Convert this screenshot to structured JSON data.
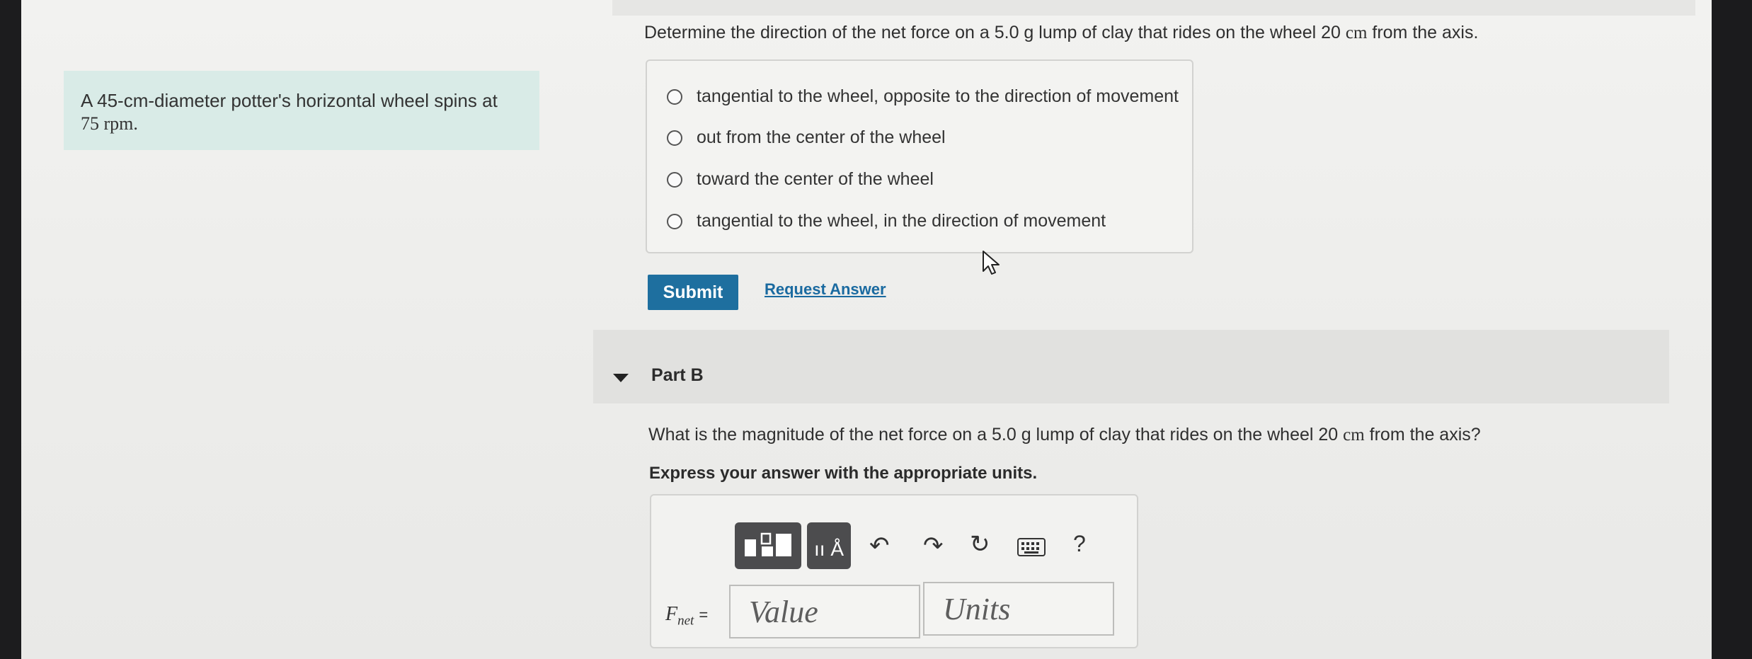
{
  "intro": {
    "text": "A 45-cm-diameter potter's horizontal wheel spins at",
    "rate": "75 rpm."
  },
  "part_a": {
    "question_prefix": "Determine the direction of the net force on a 5.0 g lump of clay that rides on the wheel 20",
    "question_unit": "cm",
    "question_suffix": "from the axis.",
    "options": [
      "tangential to the wheel, opposite to the direction of movement",
      "out from the center of the wheel",
      "toward the center of the wheel",
      "tangential to the wheel, in the direction of movement"
    ],
    "submit_label": "Submit",
    "request_label": "Request Answer"
  },
  "part_b": {
    "title": "Part B",
    "question_prefix": "What is the magnitude of the net force on a 5.0 g lump of clay that rides on the wheel 20",
    "question_unit": "cm",
    "question_suffix": "from the axis?",
    "instruction": "Express your answer with the appropriate units.",
    "help_label": "?",
    "units_tool_label": "ıı Å",
    "answer_label_main": "F",
    "answer_label_sub": "net",
    "answer_equals": "=",
    "value_placeholder": "Value",
    "units_placeholder": "Units"
  },
  "colors": {
    "accent": "#1e6f9f",
    "intro_bg": "#d9ebe7",
    "link": "#1a6aa0"
  },
  "icons": [
    "radio-icon",
    "cursor-arrow-icon",
    "collapse-triangle-icon",
    "templates-icon",
    "units-icon",
    "undo-icon",
    "redo-icon",
    "reset-icon",
    "keyboard-icon",
    "help-icon"
  ]
}
